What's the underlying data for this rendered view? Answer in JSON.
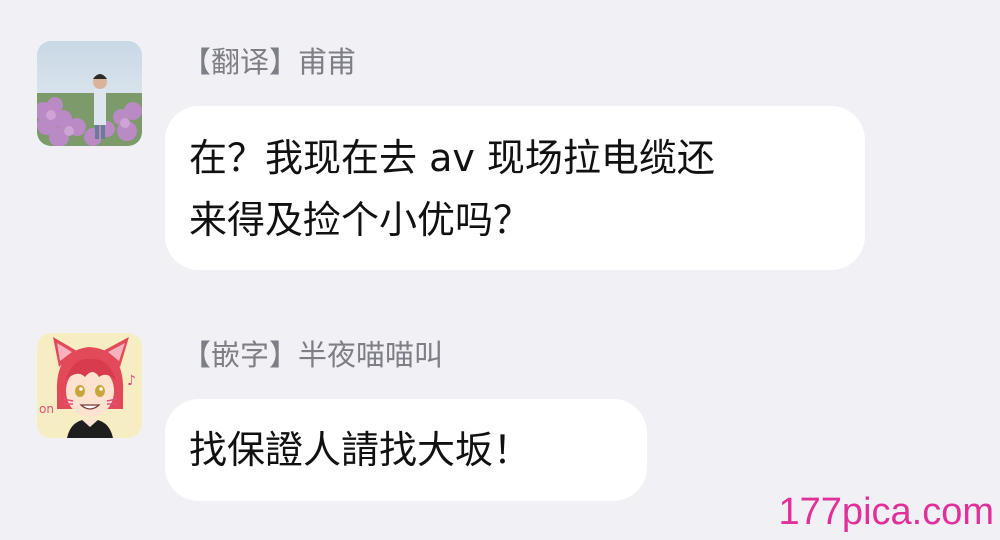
{
  "messages": [
    {
      "sender": "【翻译】甫甫",
      "lines": [
        "在？我现在去 av 现场拉电缆还",
        "来得及捡个小优吗？"
      ]
    },
    {
      "sender": "【嵌字】半夜喵喵叫",
      "lines": [
        "找保證人請找大坂！"
      ]
    }
  ],
  "watermark": "177pica.com",
  "colors": {
    "background": "#f1f1f5",
    "bubble": "#ffffff",
    "sender_text": "#7e7e86",
    "watermark": "#e0309a"
  },
  "icons": {
    "avatar_1": "person-in-flower-field-avatar",
    "avatar_2": "red-haired-cat-ear-anime-avatar"
  }
}
